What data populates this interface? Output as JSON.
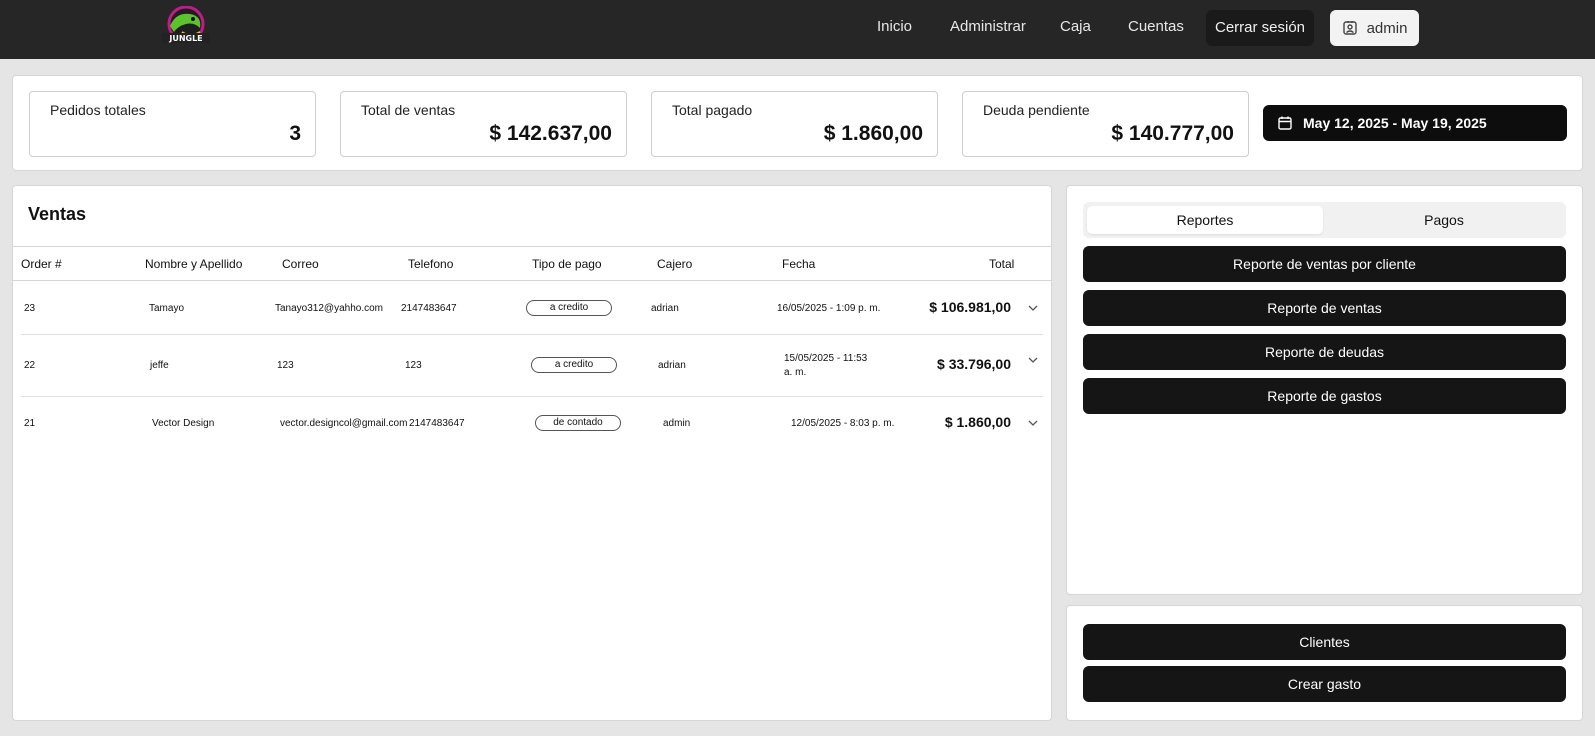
{
  "header": {
    "logo_text": "JUNGLE",
    "nav": [
      "Inicio",
      "Administrar",
      "Caja",
      "Cuentas"
    ],
    "logout_label": "Cerrar sesión",
    "user_label": "admin"
  },
  "stats": [
    {
      "label": "Pedidos totales",
      "value": "3"
    },
    {
      "label": "Total de ventas",
      "value": "$ 142.637,00"
    },
    {
      "label": "Total pagado",
      "value": "$ 1.860,00"
    },
    {
      "label": "Deuda pendiente",
      "value": "$ 140.777,00"
    }
  ],
  "date_range": "May 12, 2025 - May 19, 2025",
  "sales": {
    "title": "Ventas",
    "columns": [
      "Order #",
      "Nombre y Apellido",
      "Correo",
      "Telefono",
      "Tipo de pago",
      "Cajero",
      "Fecha",
      "Total"
    ],
    "rows": [
      {
        "order": "23",
        "name": "Tamayo",
        "email": "Tanayo312@yahho.com",
        "phone": "2147483647",
        "payment": "a credito",
        "cashier": "adrian",
        "date": "16/05/2025 - 1:09 p. m.",
        "date2": "",
        "total": "$ 106.981,00"
      },
      {
        "order": "22",
        "name": "jeffe",
        "email": "123",
        "phone": "123",
        "payment": "a credito",
        "cashier": "adrian",
        "date": "15/05/2025 - 11:53",
        "date2": "a. m.",
        "total": "$ 33.796,00"
      },
      {
        "order": "21",
        "name": "Vector Design",
        "email": "vector.designcol@gmail.com",
        "phone": "2147483647",
        "payment": "de contado",
        "cashier": "admin",
        "date": "12/05/2025 - 8:03 p. m.",
        "date2": "",
        "total": "$ 1.860,00"
      }
    ]
  },
  "reports": {
    "tabs": [
      "Reportes",
      "Pagos"
    ],
    "active_tab": "Reportes",
    "buttons": [
      "Reporte de ventas por cliente",
      "Reporte de ventas",
      "Reporte de deudas",
      "Reporte de gastos"
    ]
  },
  "actions": {
    "buttons": [
      "Clientes",
      "Crear gasto"
    ]
  }
}
